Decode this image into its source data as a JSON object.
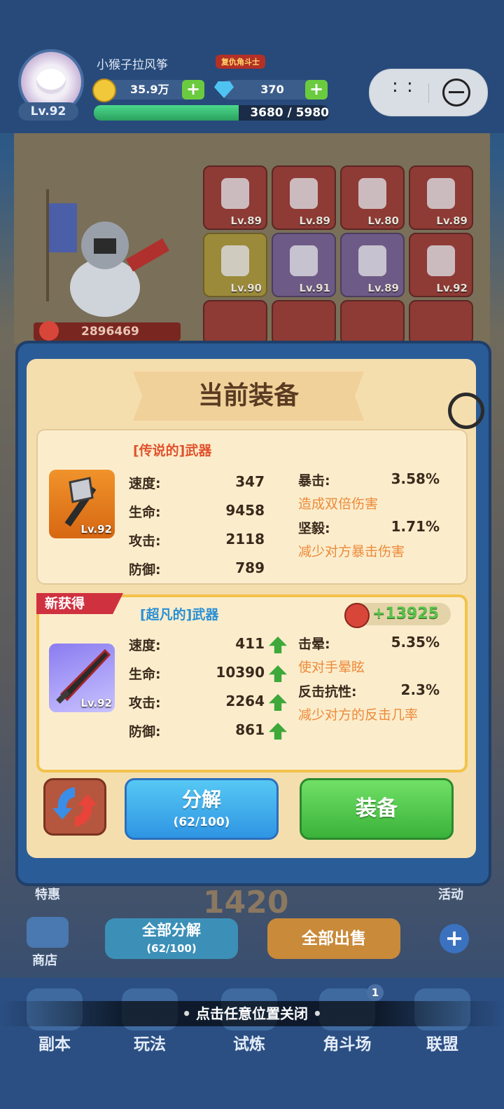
{
  "player": {
    "name": "小猴子拉风筝",
    "level": "Lv.92",
    "title_badge": "复仇角斗士",
    "coins": "35.9万",
    "gems": "370",
    "xp_text": "3680 / 5980",
    "xp_fraction": 0.615
  },
  "scene": {
    "power": "2896469",
    "equip_grid": [
      {
        "icon": "helmet-icon",
        "level": "Lv.89"
      },
      {
        "icon": "armor-icon",
        "level": "Lv.89"
      },
      {
        "icon": "pants-icon",
        "level": "Lv.80"
      },
      {
        "icon": "glove-icon",
        "level": "Lv.89"
      },
      {
        "icon": "necklace-icon",
        "level": "Lv.90"
      },
      {
        "icon": "bracelet-icon",
        "level": "Lv.91"
      },
      {
        "icon": "boots-icon",
        "level": "Lv.89"
      },
      {
        "icon": "axe-icon",
        "level": "Lv.92"
      }
    ]
  },
  "dialog": {
    "title": "当前装备",
    "current": {
      "rarity": "[传说的]武器",
      "level": "Lv.92",
      "stats": [
        {
          "label": "速度:",
          "value": "347"
        },
        {
          "label": "生命:",
          "value": "9458"
        },
        {
          "label": "攻击:",
          "value": "2118"
        },
        {
          "label": "防御:",
          "value": "789"
        }
      ],
      "specials": [
        {
          "label": "暴击:",
          "value": "3.58%",
          "desc": "造成双倍伤害"
        },
        {
          "label": "坚毅:",
          "value": "1.71%",
          "desc": "减少对方暴击伤害"
        }
      ]
    },
    "new_item": {
      "tag": "新获得",
      "rarity": "[超凡的]武器",
      "level": "Lv.92",
      "power_gain": "+13925",
      "stats": [
        {
          "label": "速度:",
          "value": "411"
        },
        {
          "label": "生命:",
          "value": "10390"
        },
        {
          "label": "攻击:",
          "value": "2264"
        },
        {
          "label": "防御:",
          "value": "861"
        }
      ],
      "specials": [
        {
          "label": "击晕:",
          "value": "5.35%",
          "desc": "使对手晕眩"
        },
        {
          "label": "反击抗性:",
          "value": "2.3%",
          "desc": "减少对方的反击几率"
        }
      ]
    },
    "buttons": {
      "decompose_label": "分解",
      "decompose_count": "(62/100)",
      "equip_label": "装备"
    }
  },
  "lower": {
    "left_label": "特惠",
    "right_label": "活动",
    "shop_label": "商店",
    "decompose_all": "全部分解",
    "decompose_all_count": "(62/100)",
    "sell_all": "全部出售",
    "bg_number": "1420"
  },
  "hint": "点击任意位置关闭",
  "nav": {
    "items": [
      "副本",
      "玩法",
      "试炼",
      "角斗场",
      "联盟"
    ],
    "arena_badge": "1"
  }
}
